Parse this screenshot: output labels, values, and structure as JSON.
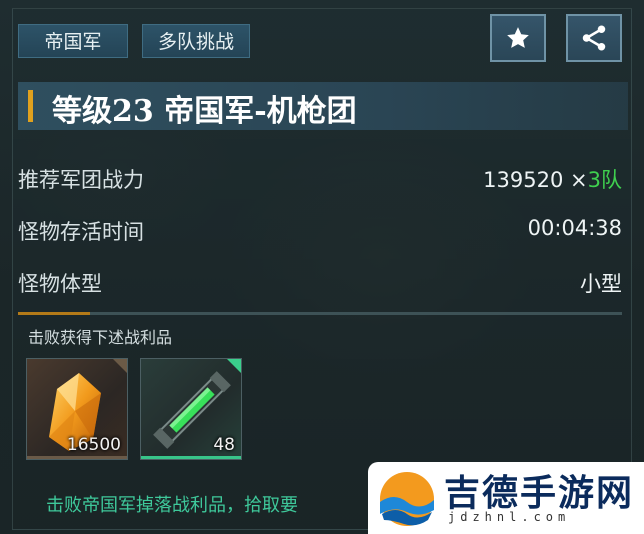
{
  "tabs": {
    "faction": "帝国军",
    "mode": "多队挑战"
  },
  "actions": {
    "favorite_icon": "star-icon",
    "share_icon": "share-icon"
  },
  "title": {
    "text": "等级23  帝国军-机枪团",
    "accent_color": "#e0a11e"
  },
  "stats": {
    "power": {
      "label": "推荐军团战力",
      "value": "139520",
      "multiplier": "×",
      "teams": "3队"
    },
    "survival": {
      "label": "怪物存活时间",
      "value": "00:04:38"
    },
    "size": {
      "label": "怪物体型",
      "value": "小型"
    }
  },
  "rewards": {
    "heading": "击败获得下述战利品",
    "items": [
      {
        "name": "amber-crystal",
        "count": "16500"
      },
      {
        "name": "green-energy-tube",
        "count": "48"
      }
    ]
  },
  "footer_note": "击败帝国军掉落战利品，拾取要",
  "watermark": {
    "brand": "吉德手游网",
    "url": "jdzhnl.com"
  }
}
